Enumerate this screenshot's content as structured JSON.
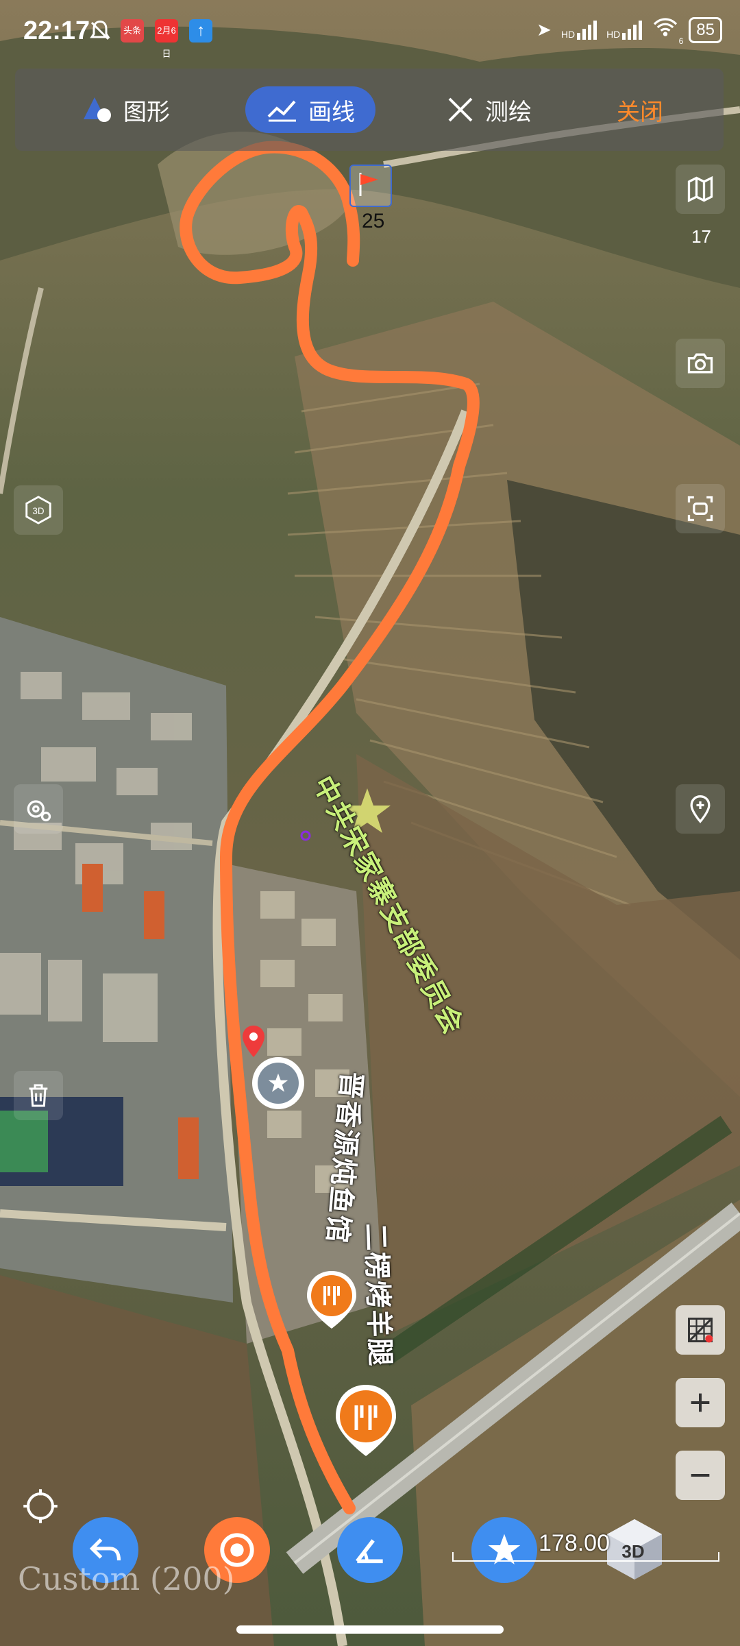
{
  "status_bar": {
    "time": "22:17",
    "app_badge_1": "头条",
    "app_badge_2": "2月6日",
    "signal_1": "HD",
    "signal_2": "HD",
    "wifi_badge": "6",
    "battery": "85"
  },
  "toolbar": {
    "shape_label": "图形",
    "line_label": "画线",
    "measure_label": "测绘",
    "close_label": "关闭"
  },
  "map": {
    "marker_number": "25",
    "zoom_level": "17",
    "poi_labels": [
      "中共宋家寨支部委员会",
      "晋香源炖鱼馆",
      "二楞烤羊腿"
    ],
    "scale_text": "178.00",
    "watermark": "Custom (200)",
    "cube_label": "3D",
    "view_3d_label": "3D"
  },
  "colors": {
    "route": "#ff7a3a",
    "accent_blue": "#3f6bd0",
    "orange": "#ff8a2b"
  }
}
